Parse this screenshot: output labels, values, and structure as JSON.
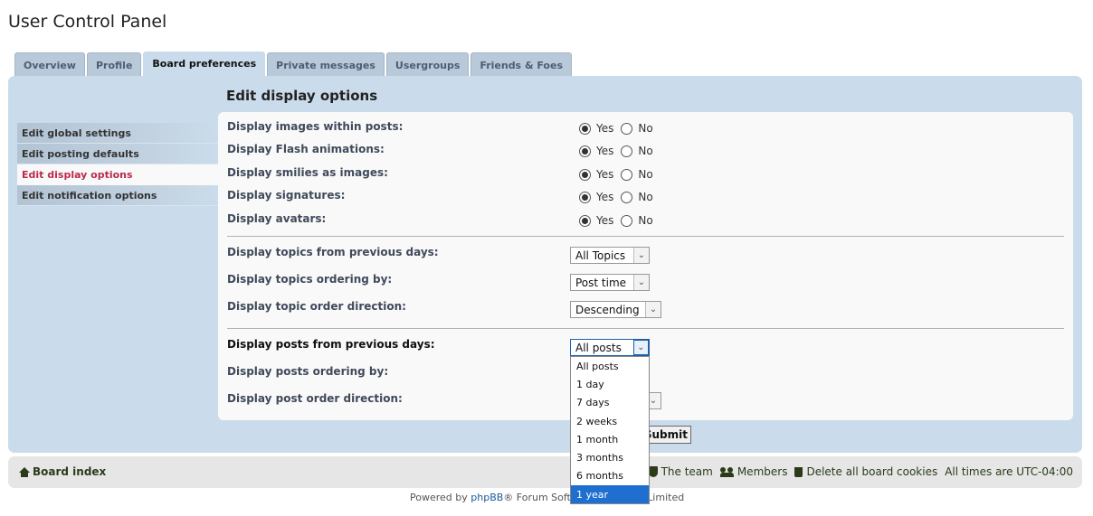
{
  "page_title": "User Control Panel",
  "tabs": [
    {
      "label": "Overview"
    },
    {
      "label": "Profile"
    },
    {
      "label": "Board preferences",
      "active": true
    },
    {
      "label": "Private messages"
    },
    {
      "label": "Usergroups"
    },
    {
      "label": "Friends & Foes"
    }
  ],
  "sidebar": {
    "items": [
      {
        "label": "Edit global settings"
      },
      {
        "label": "Edit posting defaults"
      },
      {
        "label": "Edit display options",
        "active": true
      },
      {
        "label": "Edit notification options"
      }
    ]
  },
  "section_heading": "Edit display options",
  "radio_options": {
    "yes": "Yes",
    "no": "No"
  },
  "radio_rows": [
    {
      "label": "Display images within posts:",
      "value": "Yes"
    },
    {
      "label": "Display Flash animations:",
      "value": "Yes"
    },
    {
      "label": "Display smilies as images:",
      "value": "Yes"
    },
    {
      "label": "Display signatures:",
      "value": "Yes"
    },
    {
      "label": "Display avatars:",
      "value": "Yes"
    }
  ],
  "topic_rows": [
    {
      "label": "Display topics from previous days:",
      "value": "All Topics"
    },
    {
      "label": "Display topics ordering by:",
      "value": "Post time"
    },
    {
      "label": "Display topic order direction:",
      "value": "Descending"
    }
  ],
  "post_rows": [
    {
      "label": "Display posts from previous days:",
      "value": "All posts"
    },
    {
      "label": "Display posts ordering by:",
      "value": ""
    },
    {
      "label": "Display post order direction:",
      "value": ""
    }
  ],
  "dropdown": {
    "options": [
      "All posts",
      "1 day",
      "7 days",
      "2 weeks",
      "1 month",
      "3 months",
      "6 months",
      "1 year"
    ],
    "highlighted": "1 year"
  },
  "submit_label": "Submit",
  "navbar": {
    "board_index": "Board index",
    "the_team": "The team",
    "members": "Members",
    "delete_cookies": "Delete all board cookies",
    "timezone": "All times are UTC-04:00"
  },
  "footer": {
    "powered_by": "Powered by ",
    "phpbb": "phpBB",
    "rest": "® Forum Software © phpBB Limited"
  }
}
